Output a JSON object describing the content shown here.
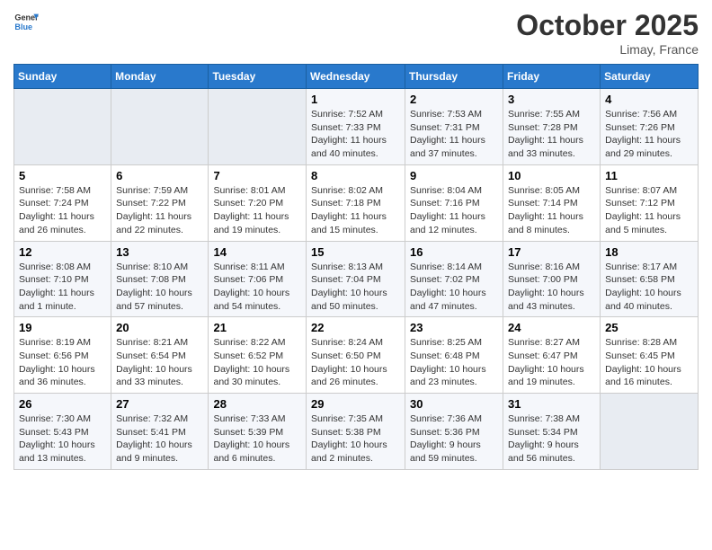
{
  "header": {
    "logo_general": "General",
    "logo_blue": "Blue",
    "month": "October 2025",
    "location": "Limay, France"
  },
  "days_of_week": [
    "Sunday",
    "Monday",
    "Tuesday",
    "Wednesday",
    "Thursday",
    "Friday",
    "Saturday"
  ],
  "weeks": [
    [
      {
        "day": "",
        "info": ""
      },
      {
        "day": "",
        "info": ""
      },
      {
        "day": "",
        "info": ""
      },
      {
        "day": "1",
        "info": "Sunrise: 7:52 AM\nSunset: 7:33 PM\nDaylight: 11 hours and 40 minutes."
      },
      {
        "day": "2",
        "info": "Sunrise: 7:53 AM\nSunset: 7:31 PM\nDaylight: 11 hours and 37 minutes."
      },
      {
        "day": "3",
        "info": "Sunrise: 7:55 AM\nSunset: 7:28 PM\nDaylight: 11 hours and 33 minutes."
      },
      {
        "day": "4",
        "info": "Sunrise: 7:56 AM\nSunset: 7:26 PM\nDaylight: 11 hours and 29 minutes."
      }
    ],
    [
      {
        "day": "5",
        "info": "Sunrise: 7:58 AM\nSunset: 7:24 PM\nDaylight: 11 hours and 26 minutes."
      },
      {
        "day": "6",
        "info": "Sunrise: 7:59 AM\nSunset: 7:22 PM\nDaylight: 11 hours and 22 minutes."
      },
      {
        "day": "7",
        "info": "Sunrise: 8:01 AM\nSunset: 7:20 PM\nDaylight: 11 hours and 19 minutes."
      },
      {
        "day": "8",
        "info": "Sunrise: 8:02 AM\nSunset: 7:18 PM\nDaylight: 11 hours and 15 minutes."
      },
      {
        "day": "9",
        "info": "Sunrise: 8:04 AM\nSunset: 7:16 PM\nDaylight: 11 hours and 12 minutes."
      },
      {
        "day": "10",
        "info": "Sunrise: 8:05 AM\nSunset: 7:14 PM\nDaylight: 11 hours and 8 minutes."
      },
      {
        "day": "11",
        "info": "Sunrise: 8:07 AM\nSunset: 7:12 PM\nDaylight: 11 hours and 5 minutes."
      }
    ],
    [
      {
        "day": "12",
        "info": "Sunrise: 8:08 AM\nSunset: 7:10 PM\nDaylight: 11 hours and 1 minute."
      },
      {
        "day": "13",
        "info": "Sunrise: 8:10 AM\nSunset: 7:08 PM\nDaylight: 10 hours and 57 minutes."
      },
      {
        "day": "14",
        "info": "Sunrise: 8:11 AM\nSunset: 7:06 PM\nDaylight: 10 hours and 54 minutes."
      },
      {
        "day": "15",
        "info": "Sunrise: 8:13 AM\nSunset: 7:04 PM\nDaylight: 10 hours and 50 minutes."
      },
      {
        "day": "16",
        "info": "Sunrise: 8:14 AM\nSunset: 7:02 PM\nDaylight: 10 hours and 47 minutes."
      },
      {
        "day": "17",
        "info": "Sunrise: 8:16 AM\nSunset: 7:00 PM\nDaylight: 10 hours and 43 minutes."
      },
      {
        "day": "18",
        "info": "Sunrise: 8:17 AM\nSunset: 6:58 PM\nDaylight: 10 hours and 40 minutes."
      }
    ],
    [
      {
        "day": "19",
        "info": "Sunrise: 8:19 AM\nSunset: 6:56 PM\nDaylight: 10 hours and 36 minutes."
      },
      {
        "day": "20",
        "info": "Sunrise: 8:21 AM\nSunset: 6:54 PM\nDaylight: 10 hours and 33 minutes."
      },
      {
        "day": "21",
        "info": "Sunrise: 8:22 AM\nSunset: 6:52 PM\nDaylight: 10 hours and 30 minutes."
      },
      {
        "day": "22",
        "info": "Sunrise: 8:24 AM\nSunset: 6:50 PM\nDaylight: 10 hours and 26 minutes."
      },
      {
        "day": "23",
        "info": "Sunrise: 8:25 AM\nSunset: 6:48 PM\nDaylight: 10 hours and 23 minutes."
      },
      {
        "day": "24",
        "info": "Sunrise: 8:27 AM\nSunset: 6:47 PM\nDaylight: 10 hours and 19 minutes."
      },
      {
        "day": "25",
        "info": "Sunrise: 8:28 AM\nSunset: 6:45 PM\nDaylight: 10 hours and 16 minutes."
      }
    ],
    [
      {
        "day": "26",
        "info": "Sunrise: 7:30 AM\nSunset: 5:43 PM\nDaylight: 10 hours and 13 minutes."
      },
      {
        "day": "27",
        "info": "Sunrise: 7:32 AM\nSunset: 5:41 PM\nDaylight: 10 hours and 9 minutes."
      },
      {
        "day": "28",
        "info": "Sunrise: 7:33 AM\nSunset: 5:39 PM\nDaylight: 10 hours and 6 minutes."
      },
      {
        "day": "29",
        "info": "Sunrise: 7:35 AM\nSunset: 5:38 PM\nDaylight: 10 hours and 2 minutes."
      },
      {
        "day": "30",
        "info": "Sunrise: 7:36 AM\nSunset: 5:36 PM\nDaylight: 9 hours and 59 minutes."
      },
      {
        "day": "31",
        "info": "Sunrise: 7:38 AM\nSunset: 5:34 PM\nDaylight: 9 hours and 56 minutes."
      },
      {
        "day": "",
        "info": ""
      }
    ]
  ]
}
